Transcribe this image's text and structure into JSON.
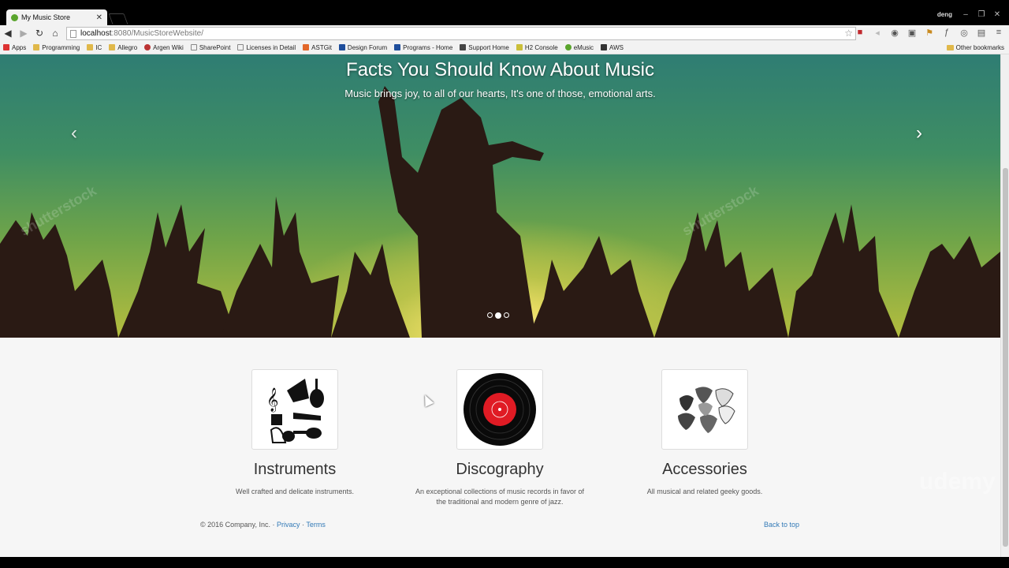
{
  "browser": {
    "tab_title": "My Music Store",
    "user": "deng",
    "url_host": "localhost",
    "url_path": ":8080/MusicStoreWebsite/",
    "bookmarks": [
      "Apps",
      "Programming",
      "IC",
      "Allegro",
      "Argen Wiki",
      "SharePoint",
      "Licenses in Detail",
      "ASTGit",
      "Design Forum",
      "Programs - Home",
      "Support Home",
      "H2 Console",
      "eMusic",
      "AWS"
    ],
    "other_bookmarks": "Other bookmarks"
  },
  "carousel": {
    "title": "Facts You Should Know About Music",
    "subtitle": "Music brings joy, to all of our hearts, It's one of those, emotional arts.",
    "prev": "‹",
    "next": "›",
    "active_slide": 2,
    "slide_count": 3,
    "watermark": "shutterstock"
  },
  "marketing": [
    {
      "title": "Instruments",
      "text": "Well crafted and delicate instruments."
    },
    {
      "title": "Discography",
      "text": "An exceptional collections of music records in favor of the traditional and modern genre of jazz."
    },
    {
      "title": "Accessories",
      "text": "All musical and related geeky goods."
    }
  ],
  "footer": {
    "copyright": "© 2016 Company, Inc.",
    "sep": "·",
    "privacy": "Privacy",
    "terms": "Terms",
    "back_to_top": "Back to top"
  },
  "watermark": "udemy"
}
